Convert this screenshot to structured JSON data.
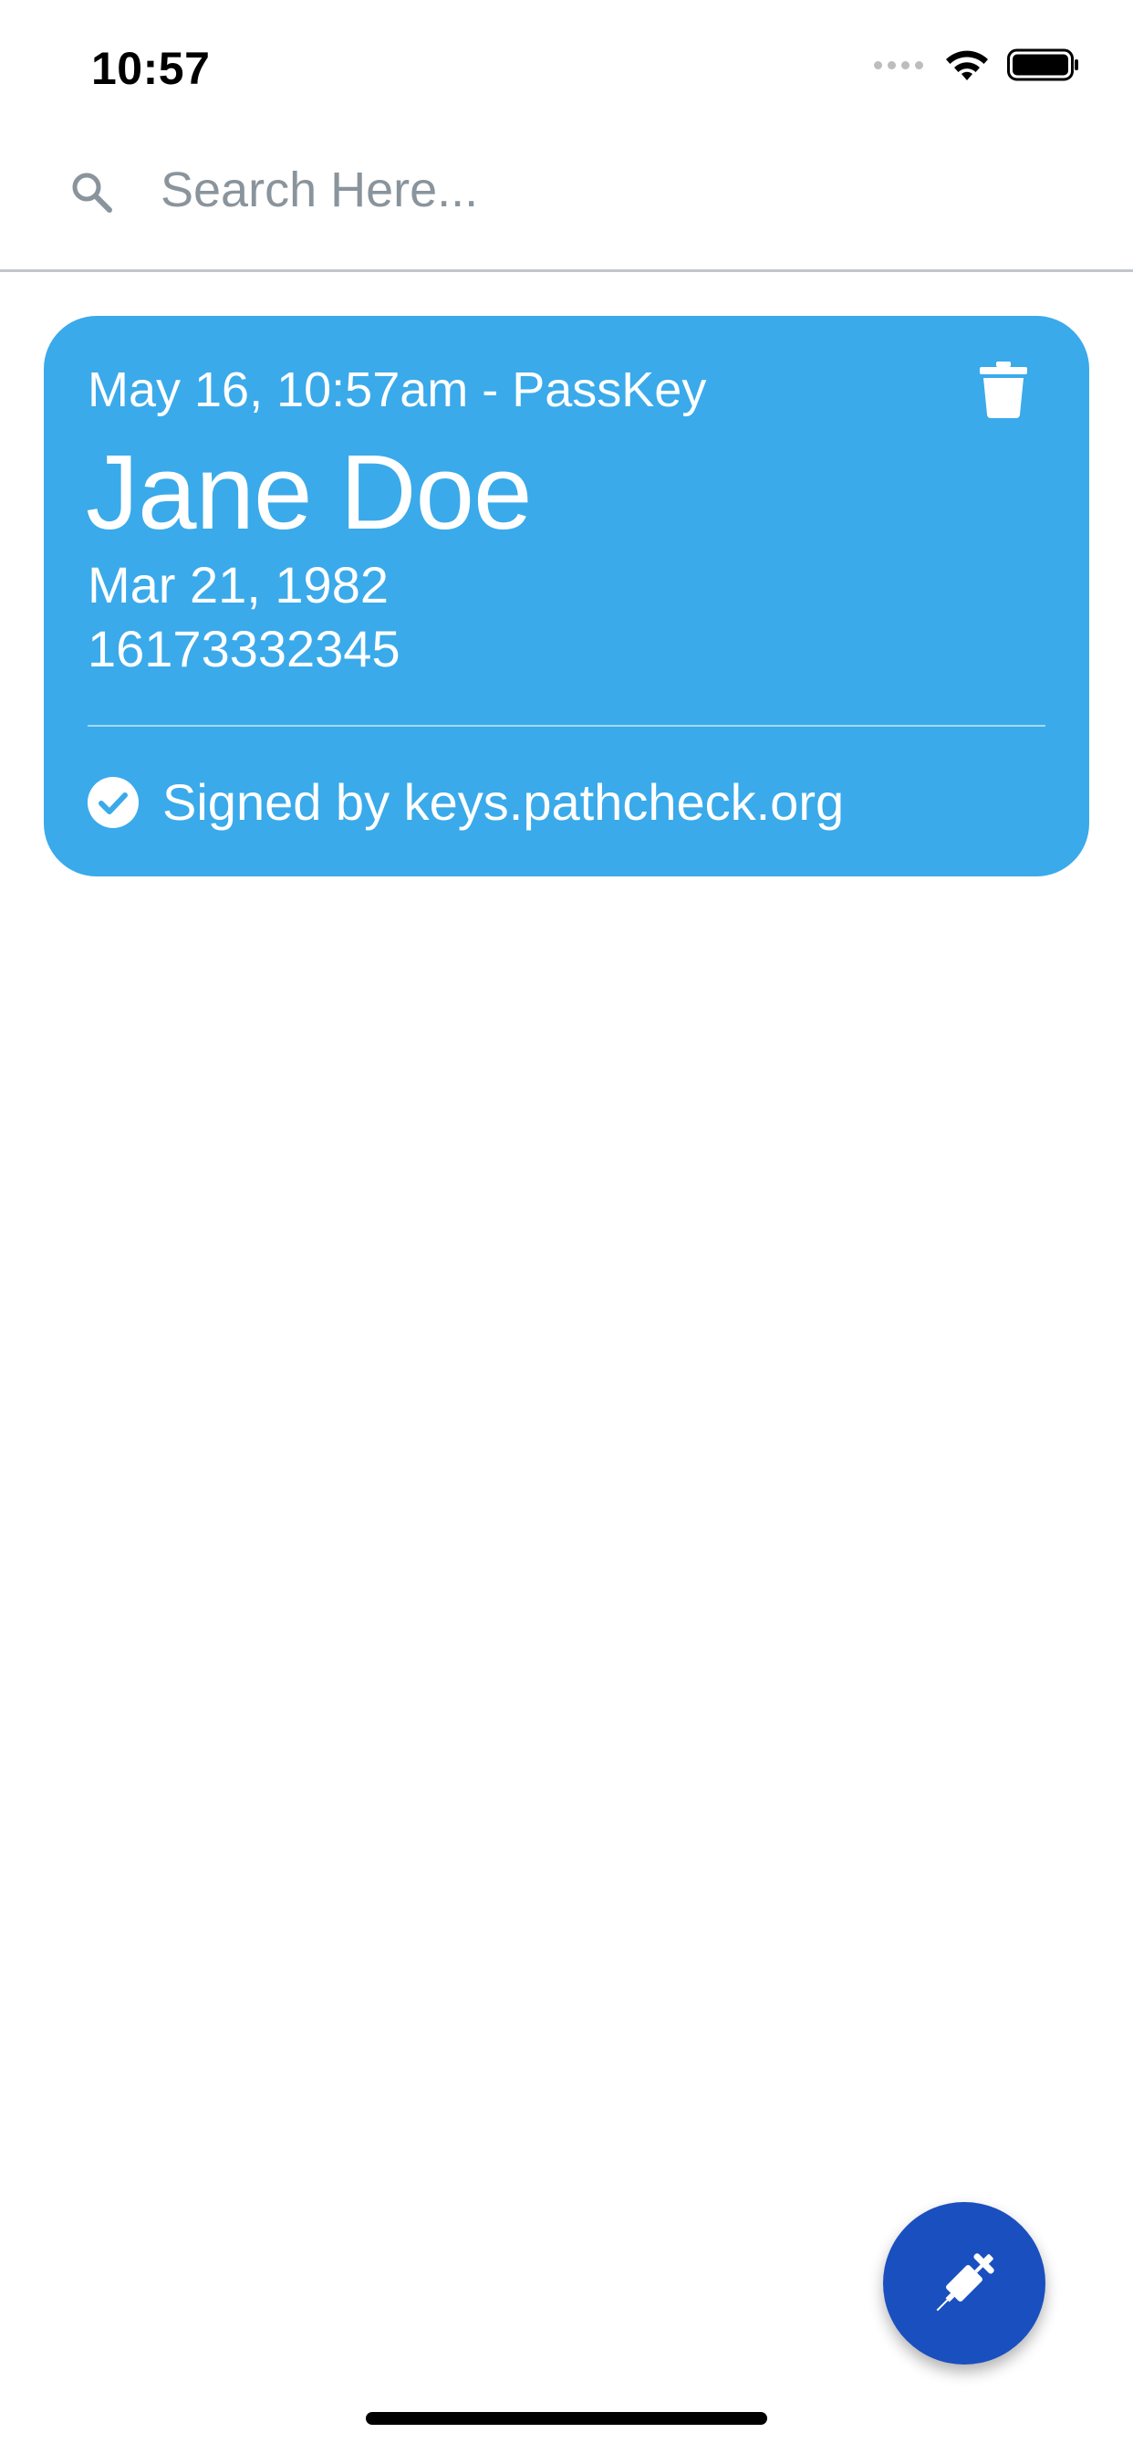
{
  "status_bar": {
    "time": "10:57"
  },
  "search": {
    "placeholder": "Search Here...",
    "value": ""
  },
  "cards": [
    {
      "meta": "May 16, 10:57am - PassKey",
      "name": "Jane Doe",
      "dob": "Mar 21, 1982",
      "phone": "16173332345",
      "signed_by": "Signed by keys.pathcheck.org",
      "icons": {
        "delete": "trash-icon",
        "verified": "check-circle-icon"
      }
    }
  ],
  "fab": {
    "icon": "syringe-icon"
  },
  "colors": {
    "card_background": "#3aaaea",
    "fab_background": "#1a4fbf",
    "search_placeholder": "#8a949c"
  }
}
